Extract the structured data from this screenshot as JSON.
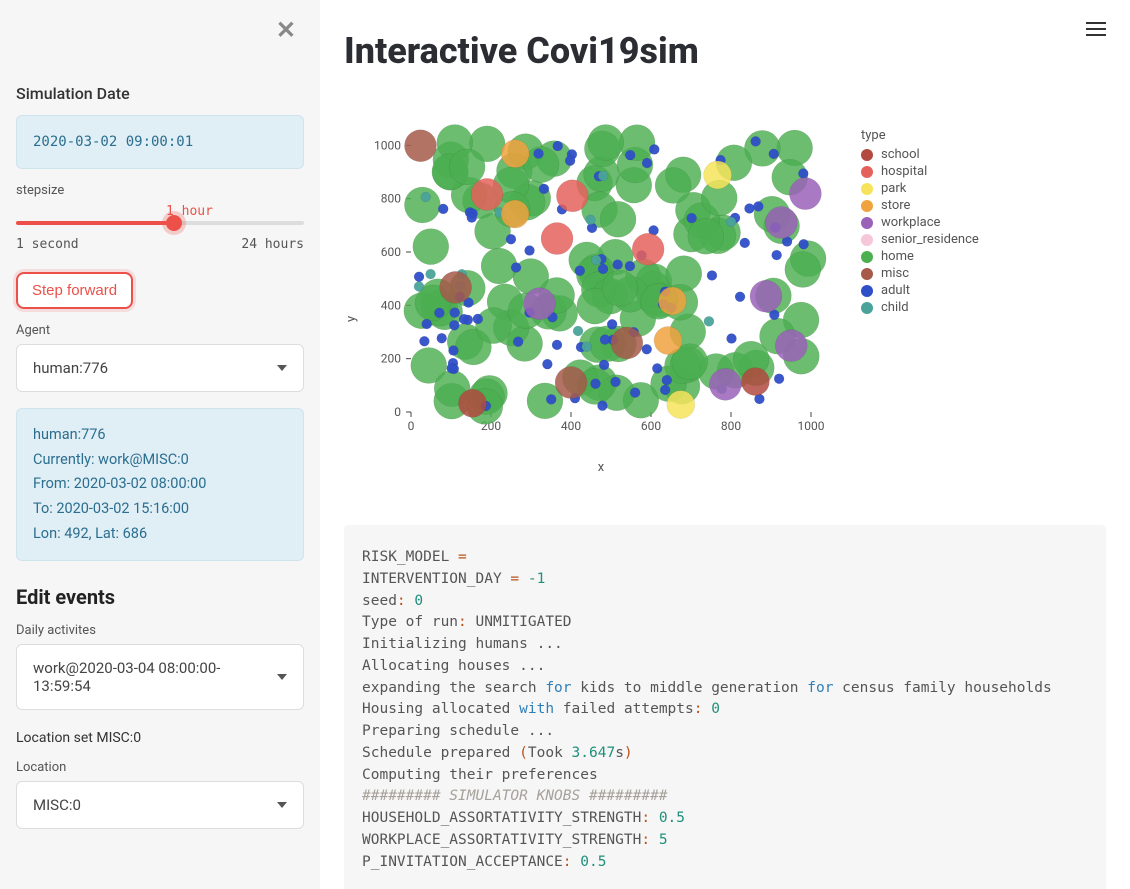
{
  "sidebar": {
    "simulation_date_label": "Simulation Date",
    "simulation_date_value": "2020-03-02 09:00:01",
    "stepsize_label": "stepsize",
    "stepsize_value": "1 hour",
    "stepsize_min_label": "1 second",
    "stepsize_max_label": "24 hours",
    "step_forward_label": "Step forward",
    "agent_label": "Agent",
    "agent_selected": "human:776",
    "agent_info": {
      "id": "human:776",
      "currently": "Currently: work@MISC:0",
      "from": "From: 2020-03-02 08:00:00",
      "to": "To: 2020-03-02 15:16:00",
      "lonlat": "Lon: 492, Lat: 686"
    },
    "edit_events_heading": "Edit events",
    "daily_activities_label": "Daily activites",
    "daily_activities_selected": "work@2020-03-04 08:00:00-13:59:54",
    "location_set_text": "Location set MISC:0",
    "location_label": "Location",
    "location_selected": "MISC:0"
  },
  "main": {
    "title": "Interactive Covi19sim"
  },
  "chart_data": {
    "type": "scatter",
    "xlabel": "x",
    "ylabel": "y",
    "xlim": [
      0,
      1050
    ],
    "ylim": [
      0,
      1050
    ],
    "xticks": [
      0,
      200,
      400,
      600,
      800,
      1000
    ],
    "yticks": [
      0,
      200,
      400,
      600,
      800,
      1000
    ],
    "legend_title": "type",
    "legend": [
      {
        "name": "school",
        "color": "#b24a3f"
      },
      {
        "name": "hospital",
        "color": "#e5625c"
      },
      {
        "name": "park",
        "color": "#f6e35a"
      },
      {
        "name": "store",
        "color": "#f0a23f"
      },
      {
        "name": "workplace",
        "color": "#9a61b9"
      },
      {
        "name": "senior_residence",
        "color": "#f6c6d9"
      },
      {
        "name": "home",
        "color": "#4caf50"
      },
      {
        "name": "misc",
        "color": "#a55a4a"
      },
      {
        "name": "adult",
        "color": "#2f4fc8"
      },
      {
        "name": "child",
        "color": "#4aa39a"
      }
    ],
    "series": [
      {
        "name": "home",
        "color": "#4caf50",
        "radius": 18,
        "opacity": 0.82,
        "count": 110
      },
      {
        "name": "adult",
        "color": "#2f4fc8",
        "radius": 5,
        "opacity": 0.95,
        "count": 85
      },
      {
        "name": "child",
        "color": "#4aa39a",
        "radius": 5,
        "opacity": 0.95,
        "count": 14
      },
      {
        "name": "workplace",
        "color": "#9a61b9",
        "radius": 16,
        "opacity": 0.85,
        "count": 6
      },
      {
        "name": "hospital",
        "color": "#e5625c",
        "radius": 16,
        "opacity": 0.85,
        "count": 4
      },
      {
        "name": "misc",
        "color": "#a55a4a",
        "radius": 16,
        "opacity": 0.85,
        "count": 4
      },
      {
        "name": "store",
        "color": "#f0a23f",
        "radius": 14,
        "opacity": 0.85,
        "count": 4
      },
      {
        "name": "school",
        "color": "#b24a3f",
        "radius": 14,
        "opacity": 0.85,
        "count": 2
      },
      {
        "name": "park",
        "color": "#f6e35a",
        "radius": 14,
        "opacity": 0.85,
        "count": 2
      }
    ]
  },
  "log": {
    "lines": [
      [
        {
          "t": "RISK_MODEL "
        },
        {
          "t": "=",
          "c": "op"
        }
      ],
      [
        {
          "t": "INTERVENTION_DAY "
        },
        {
          "t": "=",
          "c": "op"
        },
        {
          "t": " "
        },
        {
          "t": "-1",
          "c": "num"
        }
      ],
      [
        {
          "t": "seed"
        },
        {
          "t": ":",
          "c": "op"
        },
        {
          "t": " "
        },
        {
          "t": "0",
          "c": "num"
        }
      ],
      [
        {
          "t": "Type of run"
        },
        {
          "t": ":",
          "c": "op"
        },
        {
          "t": " UNMITIGATED"
        }
      ],
      [
        {
          "t": "Initializing humans ..."
        }
      ],
      [
        {
          "t": "Allocating houses ..."
        }
      ],
      [
        {
          "t": "expanding the search "
        },
        {
          "t": "for",
          "c": "kw"
        },
        {
          "t": " kids to middle generation "
        },
        {
          "t": "for",
          "c": "kw"
        },
        {
          "t": " census family households"
        }
      ],
      [
        {
          "t": "Housing allocated "
        },
        {
          "t": "with",
          "c": "kw"
        },
        {
          "t": " failed attempts"
        },
        {
          "t": ":",
          "c": "op"
        },
        {
          "t": " "
        },
        {
          "t": "0",
          "c": "num"
        }
      ],
      [
        {
          "t": "Preparing schedule ..."
        }
      ],
      [
        {
          "t": "Schedule prepared "
        },
        {
          "t": "(",
          "c": "op"
        },
        {
          "t": "Took "
        },
        {
          "t": "3.647",
          "c": "num"
        },
        {
          "t": "s"
        },
        {
          "t": ")",
          "c": "op"
        }
      ],
      [
        {
          "t": "Computing their preferences"
        }
      ],
      [
        {
          "t": ""
        }
      ],
      [
        {
          "t": "######### SIMULATOR KNOBS #########",
          "c": "cmt"
        }
      ],
      [
        {
          "t": "HOUSEHOLD_ASSORTATIVITY_STRENGTH"
        },
        {
          "t": ":",
          "c": "op"
        },
        {
          "t": " "
        },
        {
          "t": "0.5",
          "c": "num"
        }
      ],
      [
        {
          "t": "WORKPLACE_ASSORTATIVITY_STRENGTH"
        },
        {
          "t": ":",
          "c": "op"
        },
        {
          "t": " "
        },
        {
          "t": "5",
          "c": "num"
        }
      ],
      [
        {
          "t": "P_INVITATION_ACCEPTANCE"
        },
        {
          "t": ":",
          "c": "op"
        },
        {
          "t": " "
        },
        {
          "t": "0.5",
          "c": "num"
        }
      ]
    ]
  }
}
